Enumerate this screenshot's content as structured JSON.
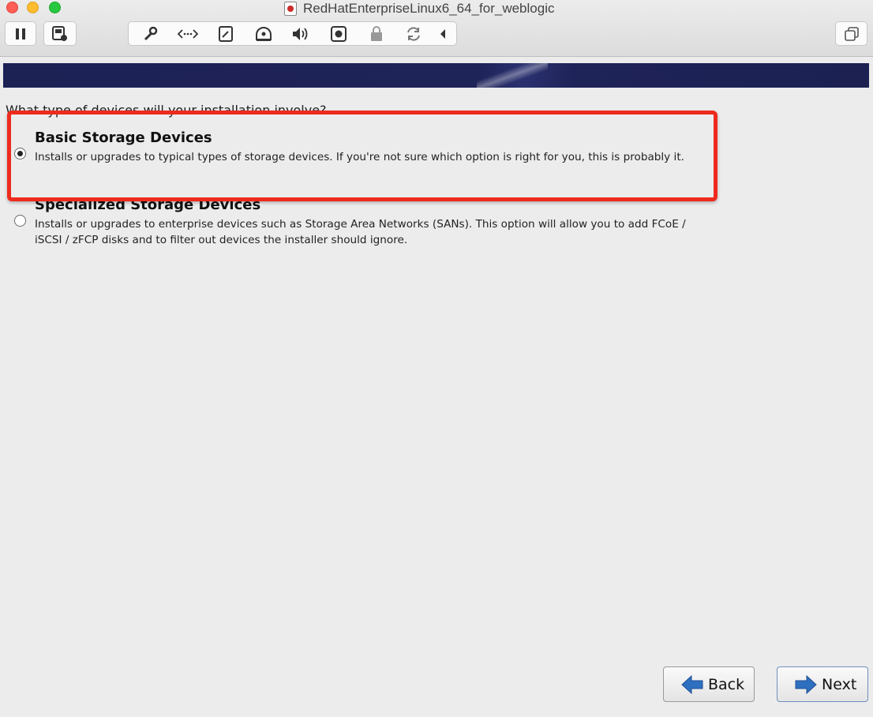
{
  "window": {
    "title": "RedHatEnterpriseLinux6_64_for_weblogic"
  },
  "toolbar": {
    "icons": [
      "pause-icon",
      "snapshot-icon",
      "settings-wrench-icon",
      "network-icon",
      "disk-icon",
      "optical-drive-icon",
      "sound-icon",
      "camera-icon",
      "usb-lock-icon",
      "sync-icon",
      "collapse-arrow-icon",
      "fullscreen-icon"
    ]
  },
  "installer": {
    "question": "What type of devices will your installation involve?",
    "options": [
      {
        "title": "Basic Storage Devices",
        "description": "Installs or upgrades to typical types of storage devices.  If you're not sure which option is right for you, this is probably it.",
        "selected": true
      },
      {
        "title": "Specialized Storage Devices",
        "description": "Installs or upgrades to enterprise devices such as Storage Area Networks (SANs). This option will allow you to add FCoE / iSCSI / zFCP disks and to filter out devices the installer should ignore.",
        "selected": false
      }
    ],
    "back_label": "Back",
    "next_label": "Next"
  },
  "colors": {
    "banner": "#1d2255",
    "highlight": "#ee2a1e",
    "arrow_blue": "#2f6fc0"
  }
}
